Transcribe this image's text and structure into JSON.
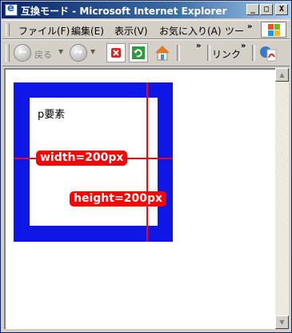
{
  "window": {
    "title": "互換モード - Microsoft Internet Explorer"
  },
  "window_controls": {
    "minimize": "_",
    "maximize": "□",
    "close": "X"
  },
  "menu": {
    "items": [
      "ファイル(F)",
      "編集(E)",
      "表示(V)",
      "お気に入り(A)",
      "ツー"
    ],
    "overflow": "»"
  },
  "toolbar": {
    "back_label": "戻る",
    "overflow": "»",
    "links_label": "リンク",
    "links_overflow": "»"
  },
  "content": {
    "paragraph_label": "p要素",
    "width_label": "width=200px",
    "height_label": "height=200px"
  },
  "colors": {
    "box_border": "#0f17e6",
    "guide_lines": "#ff0000",
    "label_bg": "#ff0000"
  }
}
